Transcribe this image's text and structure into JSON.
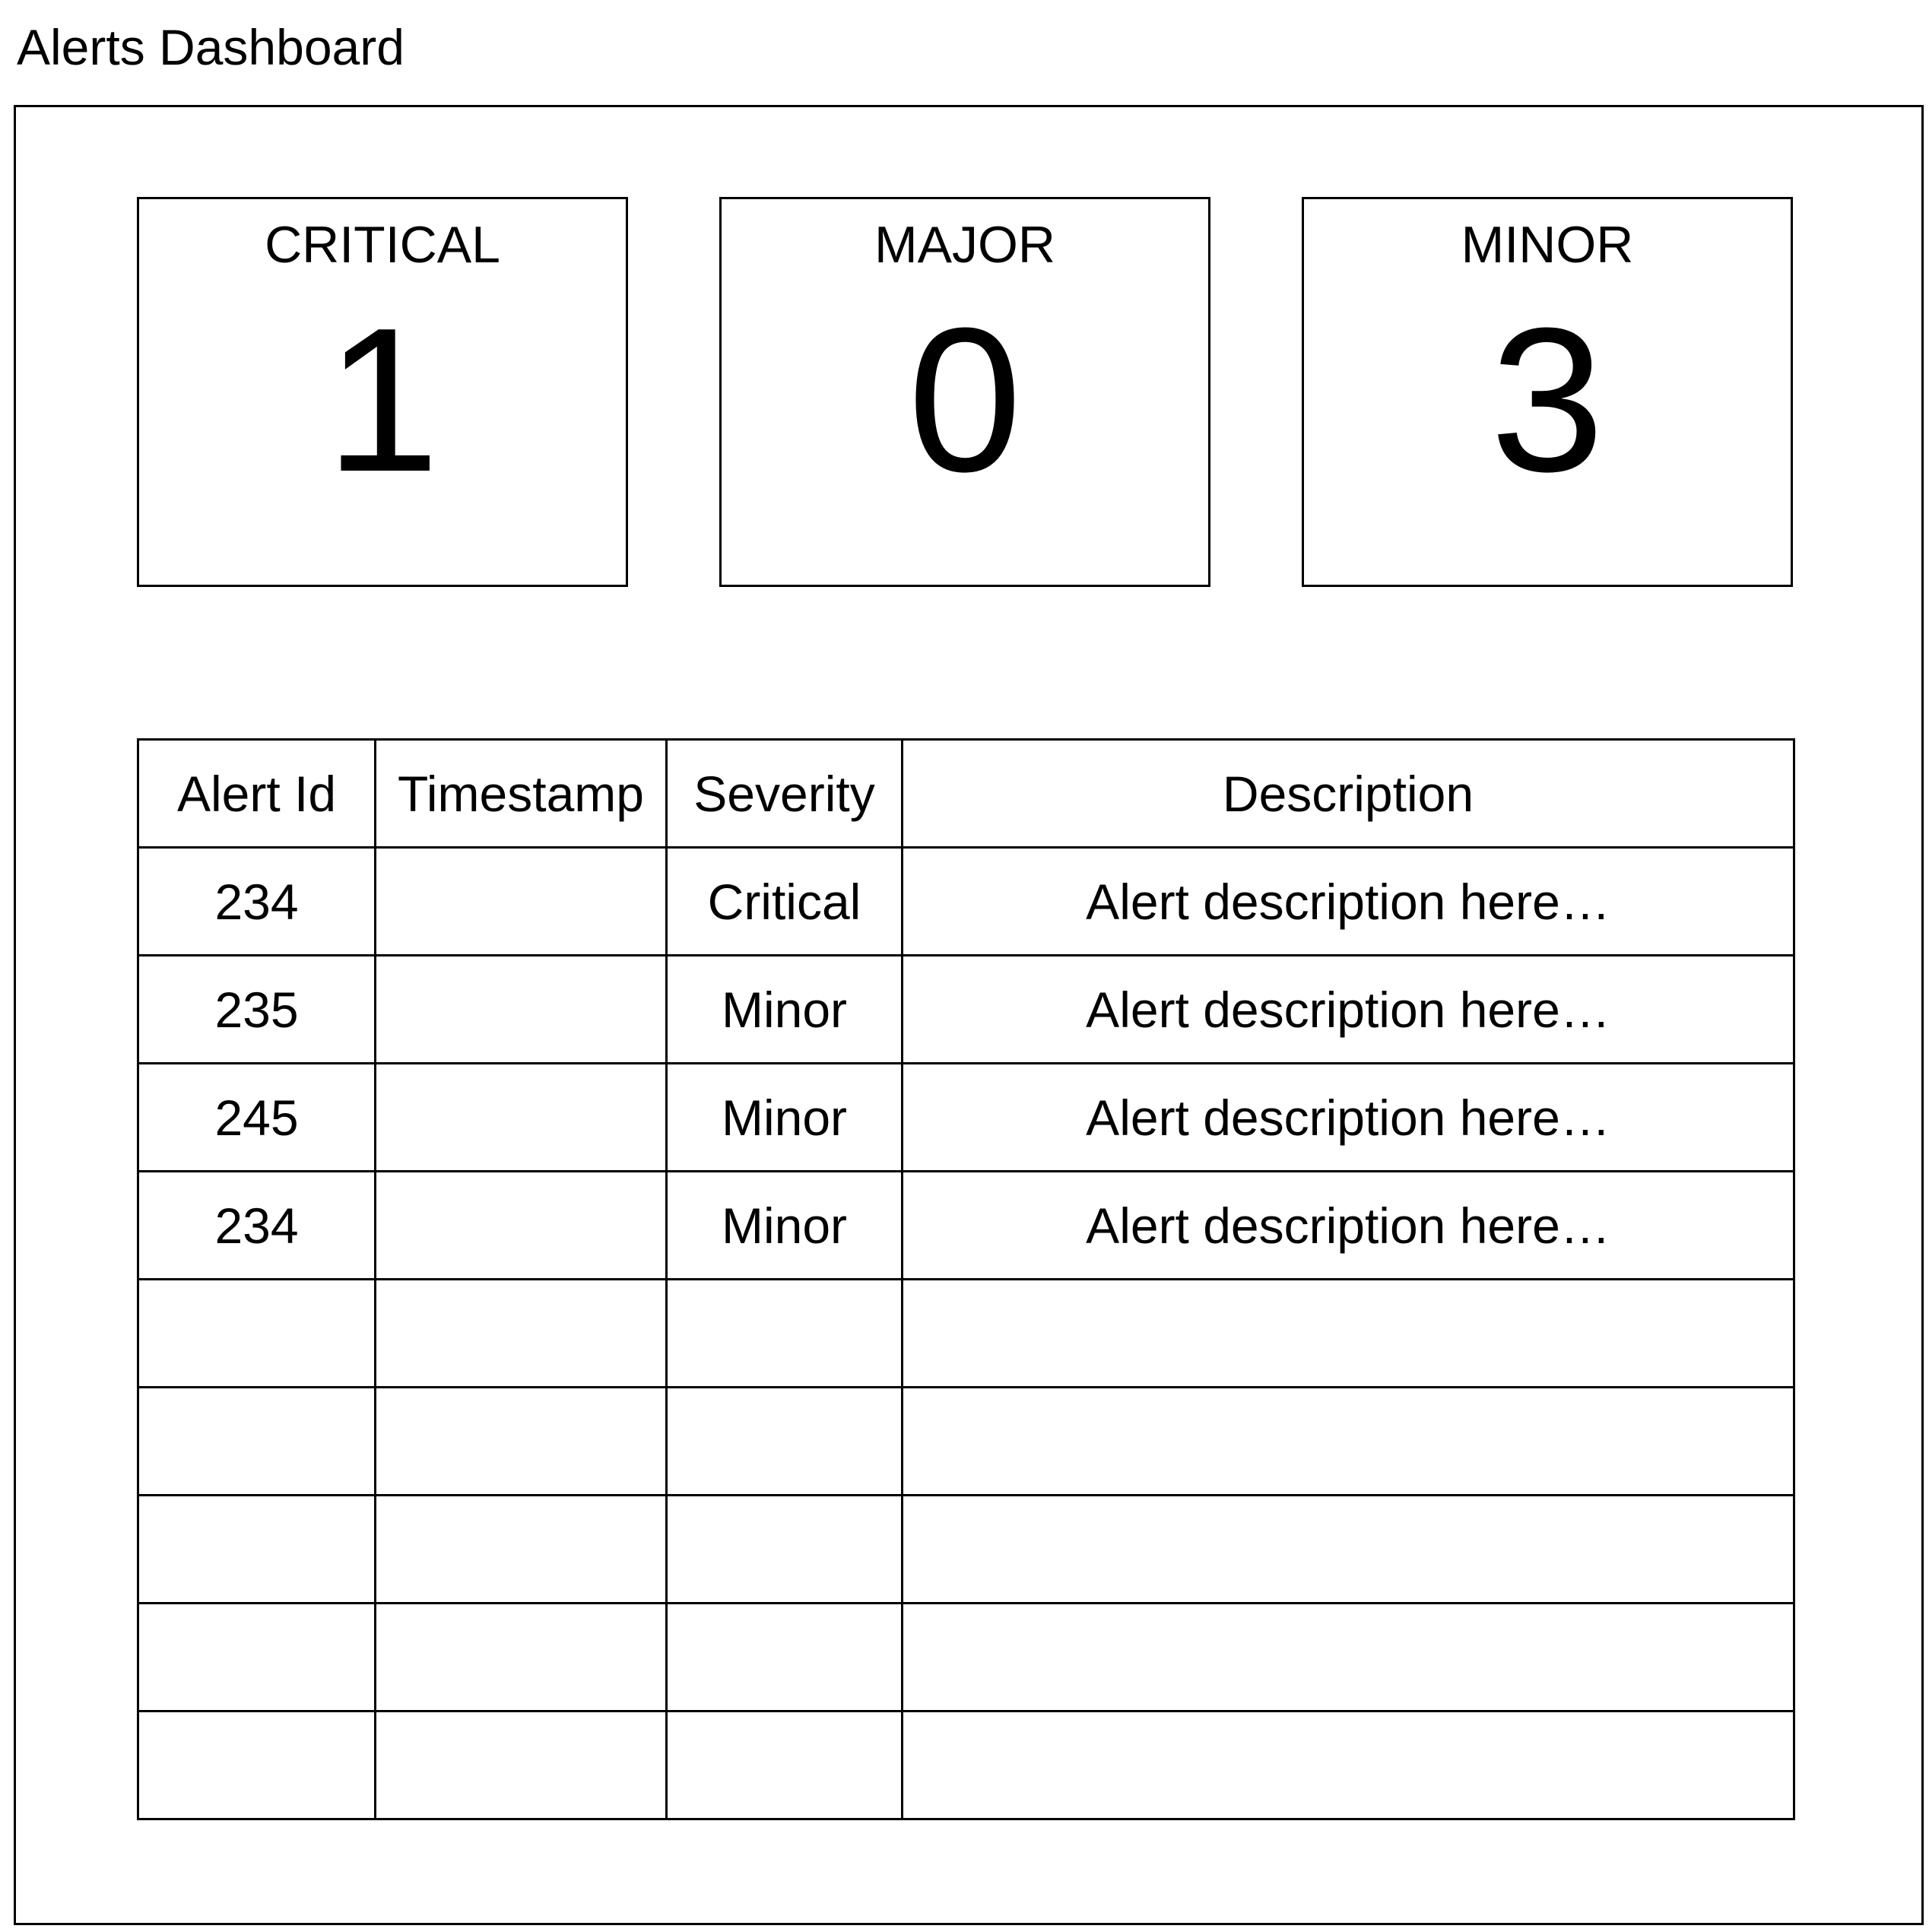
{
  "page": {
    "title": "Alerts Dashboard"
  },
  "summary": {
    "cards": [
      {
        "label": "CRITICAL",
        "count": "1"
      },
      {
        "label": "MAJOR",
        "count": "0"
      },
      {
        "label": "MINOR",
        "count": "3"
      }
    ]
  },
  "alerts_table": {
    "columns": [
      "Alert Id",
      "Timestamp",
      "Severity",
      "Description"
    ],
    "rows": [
      {
        "id": "234",
        "timestamp": "",
        "severity": "Critical",
        "description": "Alert description here…"
      },
      {
        "id": "235",
        "timestamp": "",
        "severity": "Minor",
        "description": "Alert description here…"
      },
      {
        "id": "245",
        "timestamp": "",
        "severity": "Minor",
        "description": "Alert description here…"
      },
      {
        "id": "234",
        "timestamp": "",
        "severity": "Minor",
        "description": "Alert description here…"
      },
      {
        "id": "",
        "timestamp": "",
        "severity": "",
        "description": ""
      },
      {
        "id": "",
        "timestamp": "",
        "severity": "",
        "description": ""
      },
      {
        "id": "",
        "timestamp": "",
        "severity": "",
        "description": ""
      },
      {
        "id": "",
        "timestamp": "",
        "severity": "",
        "description": ""
      },
      {
        "id": "",
        "timestamp": "",
        "severity": "",
        "description": ""
      }
    ]
  }
}
